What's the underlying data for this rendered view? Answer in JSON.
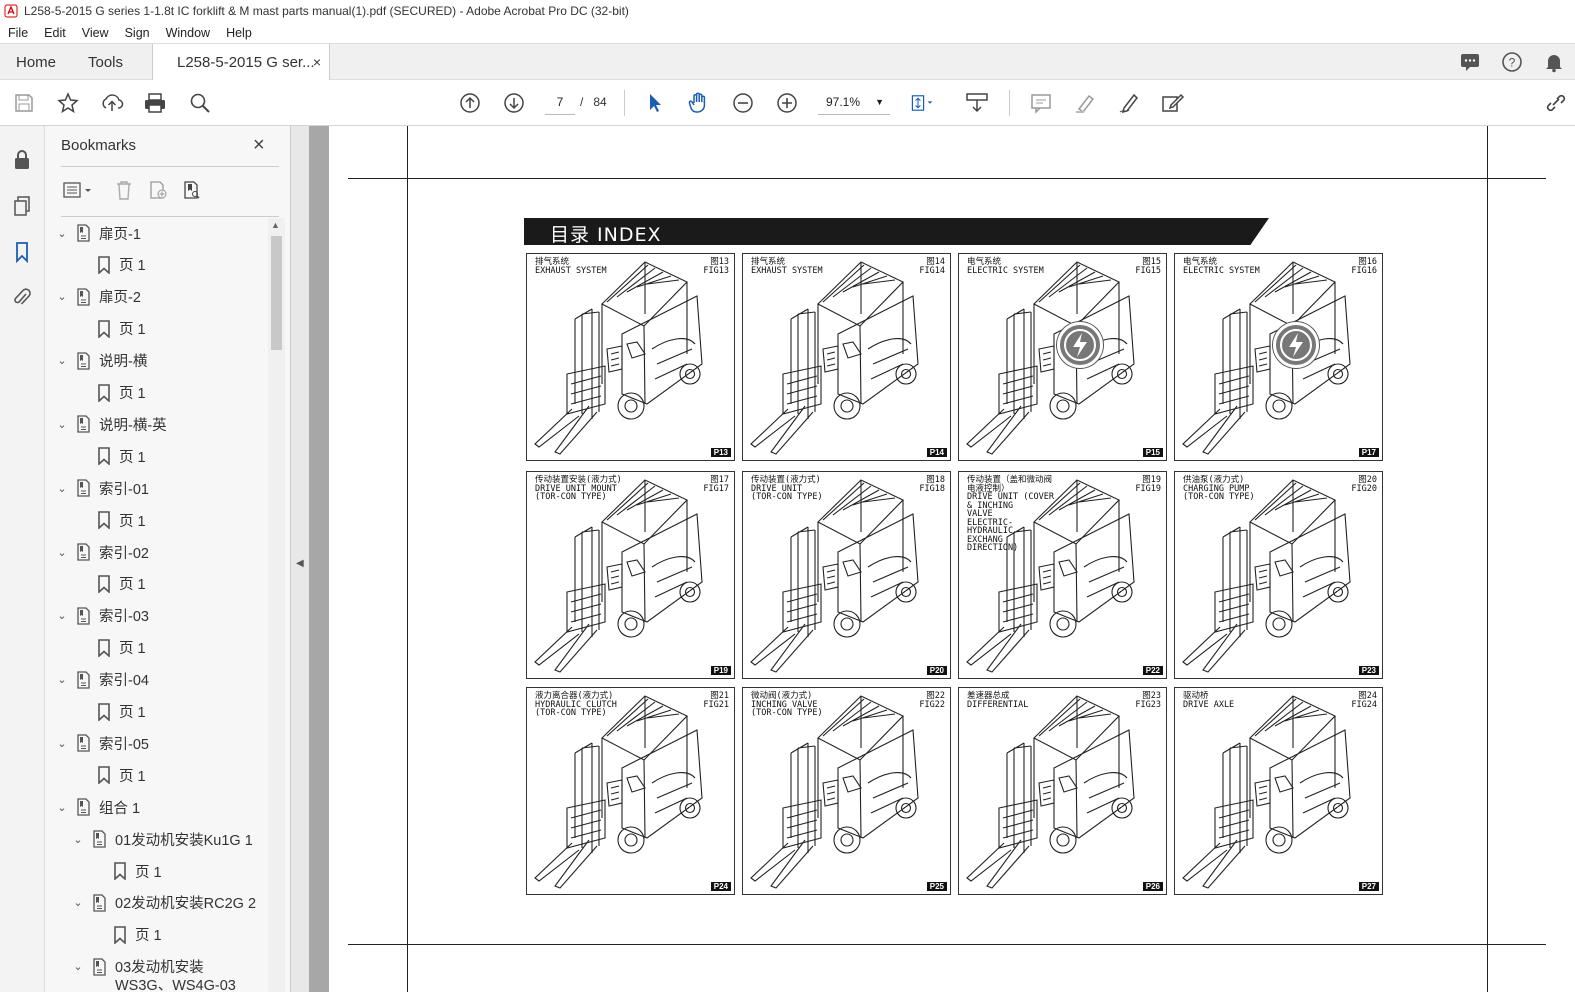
{
  "window": {
    "title": "L258-5-2015 G series 1-1.8t IC forklift & M mast parts manual(1).pdf (SECURED) - Adobe Acrobat Pro DC (32-bit)"
  },
  "menu": [
    "File",
    "Edit",
    "View",
    "Sign",
    "Window",
    "Help"
  ],
  "tabs": {
    "home": "Home",
    "tools": "Tools",
    "doc": "L258-5-2015 G ser...",
    "close": "×"
  },
  "toolbar": {
    "page_current": "7",
    "page_sep": "/",
    "page_total": "84",
    "zoom": "97.1%"
  },
  "bookmarks": {
    "title": "Bookmarks",
    "close": "×",
    "items": [
      {
        "label": "扉页-1",
        "level": 0
      },
      {
        "label": "页 1",
        "level": 1
      },
      {
        "label": "扉页-2",
        "level": 0
      },
      {
        "label": "页 1",
        "level": 1
      },
      {
        "label": "说明-横",
        "level": 0
      },
      {
        "label": "页 1",
        "level": 1
      },
      {
        "label": "说明-横-英",
        "level": 0
      },
      {
        "label": "页 1",
        "level": 1
      },
      {
        "label": "索引-01",
        "level": 0
      },
      {
        "label": "页 1",
        "level": 1
      },
      {
        "label": "索引-02",
        "level": 0
      },
      {
        "label": "页 1",
        "level": 1
      },
      {
        "label": "索引-03",
        "level": 0
      },
      {
        "label": "页 1",
        "level": 1
      },
      {
        "label": "索引-04",
        "level": 0
      },
      {
        "label": "页 1",
        "level": 1
      },
      {
        "label": "索引-05",
        "level": 0
      },
      {
        "label": "页 1",
        "level": 1
      },
      {
        "label": "组合 1",
        "level": 0
      },
      {
        "label": "01发动机安装Ku1G 1",
        "level": 1
      },
      {
        "label": "页 1",
        "level": 2
      },
      {
        "label": "02发动机安装RC2G 2",
        "level": 1
      },
      {
        "label": "页 1",
        "level": 2
      },
      {
        "label": "03发动机安装",
        "level": 1
      },
      {
        "label": "WS3G、WS4G-03",
        "level": 1
      }
    ]
  },
  "document": {
    "index_title": "目录  INDEX",
    "cells": [
      {
        "label": "排气系统\nEXHAUST SYSTEM",
        "fig": "图13\nFIG13",
        "page": "P13",
        "electric": false
      },
      {
        "label": "排气系统\nEXHAUST SYSTEM",
        "fig": "图14\nFIG14",
        "page": "P14",
        "electric": false
      },
      {
        "label": "电气系统\nELECTRIC SYSTEM",
        "fig": "图15\nFIG15",
        "page": "P15",
        "electric": true
      },
      {
        "label": "电气系统\nELECTRIC SYSTEM",
        "fig": "图16\nFIG16",
        "page": "P17",
        "electric": true
      },
      {
        "label": "传动装置安装(液力式)\nDRIVE UNIT MOUNT\n(TOR-CON TYPE)",
        "fig": "图17\nFIG17",
        "page": "P19",
        "electric": false
      },
      {
        "label": "传动装置(液力式)\nDRIVE UNIT\n(TOR-CON TYPE)",
        "fig": "图18\nFIG18",
        "page": "P20",
        "electric": false
      },
      {
        "label": "传动装置（盖和微动阀\n电液控制）\nDRIVE UNIT (COVER\n& INCHING\nVALVE\nELECTRIC-\nHYDRAULIC\nEXCHANG\nDIRECTION)",
        "fig": "图19\nFIG19",
        "page": "P22",
        "electric": false
      },
      {
        "label": "供油泵(液力式)\nCHARGING PUMP\n(TOR-CON TYPE)",
        "fig": "图20\nFIG20",
        "page": "P23",
        "electric": false
      },
      {
        "label": "液力离合器(液力式)\nHYDRAULIC CLUTCH\n(TOR-CON TYPE)",
        "fig": "图21\nFIG21",
        "page": "P24",
        "electric": false
      },
      {
        "label": "微动阀(液力式)\nINCHING VALVE\n(TOR-CON TYPE)",
        "fig": "图22\nFIG22",
        "page": "P25",
        "electric": false
      },
      {
        "label": "差速器总成\nDIFFERENTIAL",
        "fig": "图23\nFIG23",
        "page": "P26",
        "electric": false
      },
      {
        "label": "驱动桥\nDRIVE AXLE",
        "fig": "图24\nFIG24",
        "page": "P27",
        "electric": false
      }
    ]
  }
}
